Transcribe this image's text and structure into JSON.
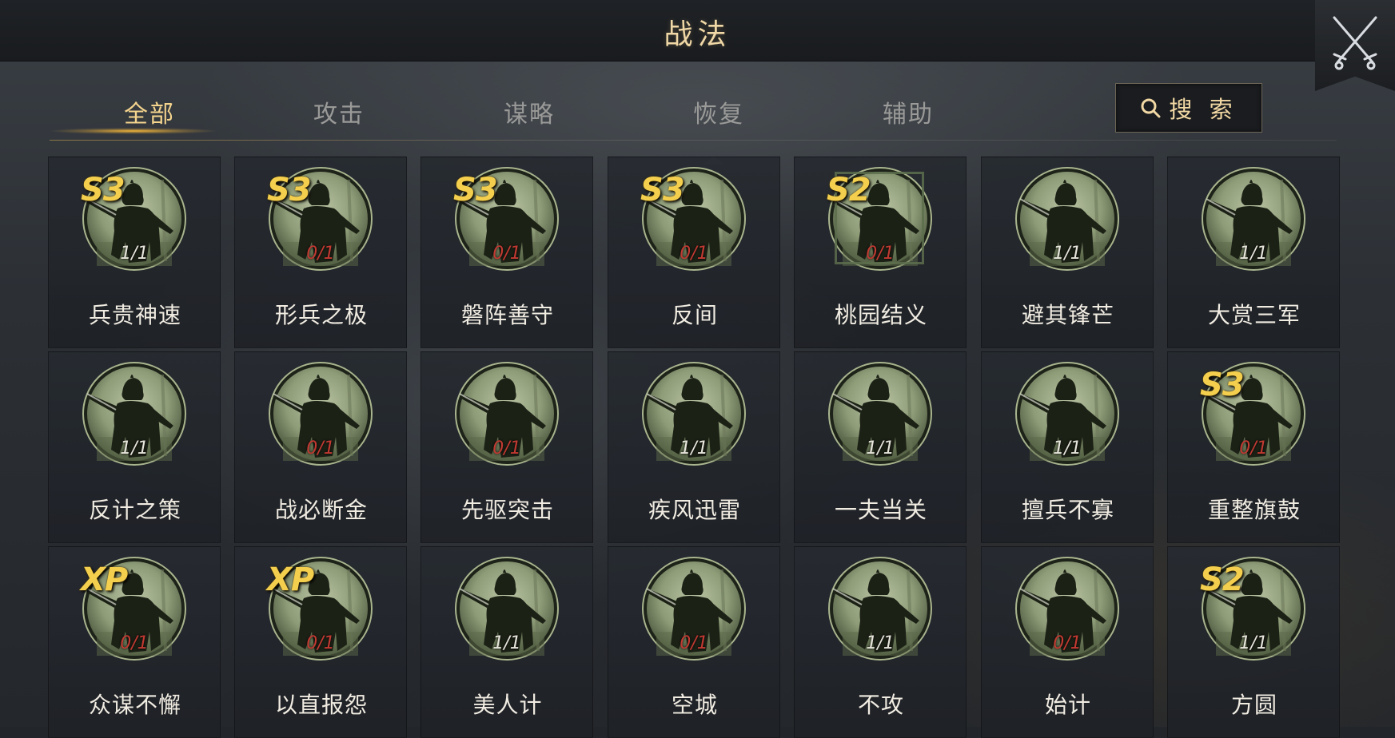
{
  "header": {
    "title": "战法"
  },
  "tabs": [
    {
      "label": "全部",
      "active": true
    },
    {
      "label": "攻击",
      "active": false
    },
    {
      "label": "谋略",
      "active": false
    },
    {
      "label": "恢复",
      "active": false
    },
    {
      "label": "辅助",
      "active": false
    }
  ],
  "search": {
    "label": "搜 索"
  },
  "colors": {
    "accent": "#f5d58e",
    "badge": "#f4cf4e",
    "zero_count": "#c23a32"
  },
  "skills": [
    {
      "name": "兵贵神速",
      "count": "1/1",
      "badge": "S3"
    },
    {
      "name": "形兵之极",
      "count": "0/1",
      "badge": "S3"
    },
    {
      "name": "磐阵善守",
      "count": "0/1",
      "badge": "S3"
    },
    {
      "name": "反间",
      "count": "0/1",
      "badge": "S3"
    },
    {
      "name": "桃园结义",
      "count": "0/1",
      "badge": "S2",
      "framed": true
    },
    {
      "name": "避其锋芒",
      "count": "1/1",
      "badge": ""
    },
    {
      "name": "大赏三军",
      "count": "1/1",
      "badge": ""
    },
    {
      "name": "反计之策",
      "count": "1/1",
      "badge": ""
    },
    {
      "name": "战必断金",
      "count": "0/1",
      "badge": ""
    },
    {
      "name": "先驱突击",
      "count": "0/1",
      "badge": ""
    },
    {
      "name": "疾风迅雷",
      "count": "1/1",
      "badge": ""
    },
    {
      "name": "一夫当关",
      "count": "1/1",
      "badge": ""
    },
    {
      "name": "擅兵不寡",
      "count": "1/1",
      "badge": ""
    },
    {
      "name": "重整旗鼓",
      "count": "0/1",
      "badge": "S3"
    },
    {
      "name": "众谋不懈",
      "count": "0/1",
      "badge": "XP"
    },
    {
      "name": "以直报怨",
      "count": "0/1",
      "badge": "XP"
    },
    {
      "name": "美人计",
      "count": "1/1",
      "badge": ""
    },
    {
      "name": "空城",
      "count": "0/1",
      "badge": ""
    },
    {
      "name": "不攻",
      "count": "1/1",
      "badge": ""
    },
    {
      "name": "始计",
      "count": "0/1",
      "badge": ""
    },
    {
      "name": "方圆",
      "count": "1/1",
      "badge": "S2"
    }
  ]
}
